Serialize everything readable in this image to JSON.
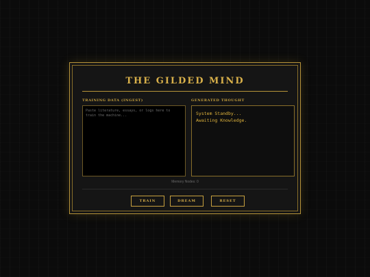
{
  "app": {
    "title": "THE GILDED MIND"
  },
  "training": {
    "label": "TRAINING DATA (INGEST)",
    "placeholder": "Paste literature, essays, or logs here to train the machine...",
    "value": ""
  },
  "generated": {
    "label": "GENERATED THOUGHT",
    "lines": [
      "System Standby...",
      "Awaiting Knowledge."
    ]
  },
  "status": {
    "memory_text": "Memory Nodes: 0"
  },
  "actions": {
    "train_label": "TRAIN",
    "dream_label": "DREAM",
    "reset_label": "RESET"
  },
  "colors": {
    "gold": "#d8b04a",
    "gold_border": "#b9953a",
    "background": "#0b0b0b",
    "panel": "#151515",
    "output_text": "#e0b43c"
  }
}
